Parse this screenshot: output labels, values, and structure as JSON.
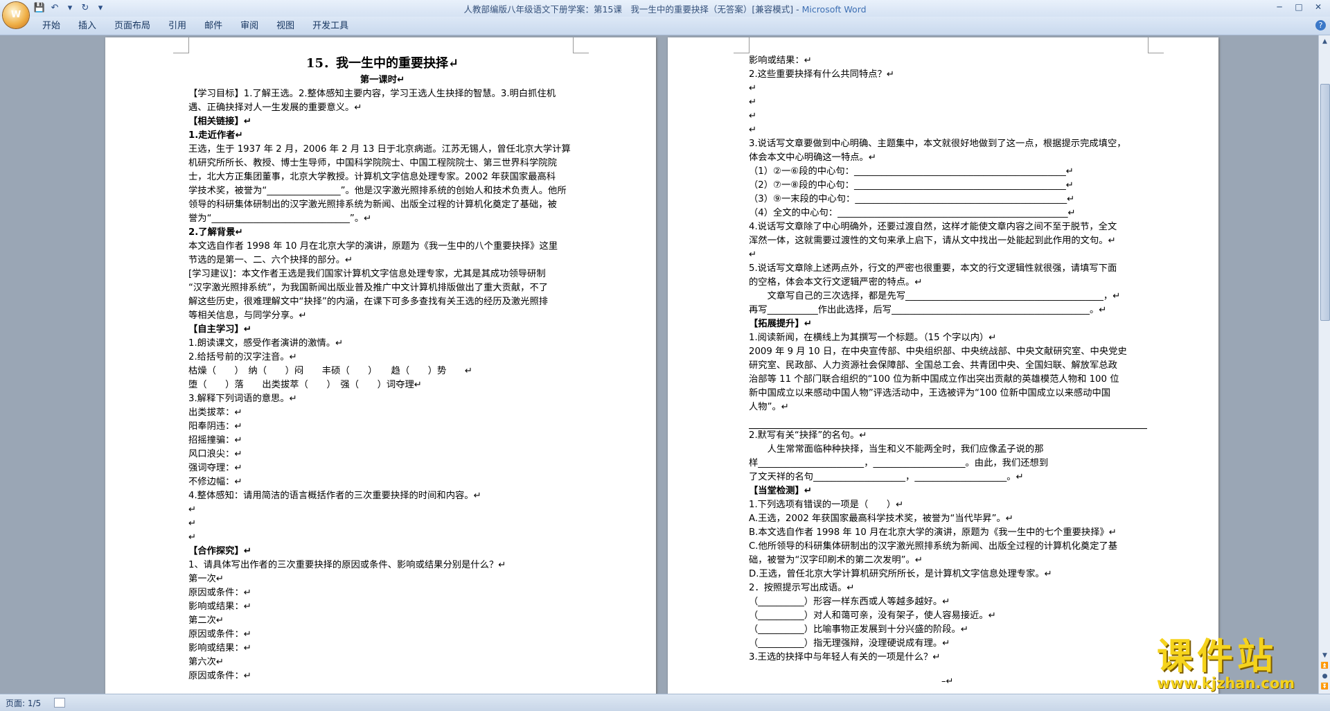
{
  "window": {
    "title": "人教部编版八年级语文下册学案：第15课　我一生中的重要抉择（无答案）[兼容模式] - ",
    "app_name": "Microsoft Word"
  },
  "office_button": {
    "icon": "office-logo-icon"
  },
  "quick_access": [
    {
      "name": "save",
      "icon": "💾"
    },
    {
      "name": "undo",
      "icon": "↶"
    },
    {
      "name": "undo-dropdown",
      "icon": "▾"
    },
    {
      "name": "redo",
      "icon": "↻"
    },
    {
      "name": "customize",
      "icon": "▾"
    }
  ],
  "window_controls": {
    "minimize": "─",
    "maximize": "□",
    "close": "✕"
  },
  "ribbon": {
    "tabs": [
      "开始",
      "插入",
      "页面布局",
      "引用",
      "邮件",
      "审阅",
      "视图",
      "开发工具"
    ],
    "help": "?"
  },
  "page1": {
    "lines": [
      {
        "t": "15．我一生中的重要抉择↵",
        "s": "title"
      },
      {
        "t": "第一课时↵",
        "s": "center"
      },
      {
        "t": "【学习目标】1.了解王选。2.整体感知主要内容，学习王选人生抉择的智慧。3.明白抓住机"
      },
      {
        "t": "遇、正确抉择对人一生发展的重要意义。↵"
      },
      {
        "t": "【相关链接】↵",
        "s": "bold"
      },
      {
        "t": "1.走近作者↵",
        "s": "bold"
      },
      {
        "t": "王选，生于 1937 年 2 月，2006 年 2 月 13 日于北京病逝。江苏无锡人，曾任北京大学计算"
      },
      {
        "t": "机研究所所长、教授、博士生导师，中国科学院院士、中国工程院院士、第三世界科学院院"
      },
      {
        "t": "士，北大方正集团董事，北京大学教授。计算机文字信息处理专家。2002 年获国家最高科"
      },
      {
        "t": "学技术奖，被誉为“________________”。他是汉字激光照排系统的创始人和技术负责人。他所"
      },
      {
        "t": "领导的科研集体研制出的汉字激光照排系统为新闻、出版全过程的计算机化奠定了基础，被"
      },
      {
        "t": "誉为“______________________________”。↵"
      },
      {
        "t": "2.了解背景↵",
        "s": "bold"
      },
      {
        "t": "本文选自作者 1998 年 10 月在北京大学的演讲，原题为《我一生中的八个重要抉择》这里"
      },
      {
        "t": "节选的是第一、二、六个抉择的部分。↵"
      },
      {
        "t": "[学习建议]：本文作者王选是我们国家计算机文字信息处理专家，尤其是其成功领导研制"
      },
      {
        "t": "“汉字激光照排系统”，为我国新闻出版业普及推广中文计算机排版做出了重大贡献，不了"
      },
      {
        "t": "解这些历史，很难理解文中“抉择”的内涵，在课下可多多查找有关王选的经历及激光照排"
      },
      {
        "t": "等相关信息，与同学分享。↵"
      },
      {
        "t": "【自主学习】↵",
        "s": "bold"
      },
      {
        "t": "1.朗读课文，感受作者演讲的激情。↵"
      },
      {
        "t": "2.给括号前的汉字注音。↵"
      },
      {
        "t": "枯燥（　　）　纳（　　）闷　　丰硕（　　）　　趋（　　）势　　↵"
      },
      {
        "t": "堕（　　）落　　出类拔萃（　　）　强（　　）词夺理↵"
      },
      {
        "t": "3.解释下列词语的意思。↵"
      },
      {
        "t": "出类拔萃：↵"
      },
      {
        "t": "阳奉阴违：↵"
      },
      {
        "t": "招摇撞骗：↵"
      },
      {
        "t": "风口浪尖：↵"
      },
      {
        "t": "强词夺理：↵"
      },
      {
        "t": "不修边幅：↵"
      },
      {
        "t": "4.整体感知：请用简洁的语言概括作者的三次重要抉择的时间和内容。↵"
      },
      {
        "t": "↵"
      },
      {
        "t": "↵"
      },
      {
        "t": "↵"
      },
      {
        "t": "【合作探究】↵",
        "s": "bold"
      },
      {
        "t": "1、请具体写出作者的三次重要抉择的原因或条件、影响或结果分别是什么？↵"
      },
      {
        "t": "第一次↵"
      },
      {
        "t": "原因或条件：↵"
      },
      {
        "t": "影响或结果：↵"
      },
      {
        "t": "第二次↵"
      },
      {
        "t": "原因或条件：↵"
      },
      {
        "t": "影响或结果：↵"
      },
      {
        "t": "第六次↵"
      },
      {
        "t": "原因或条件：↵"
      }
    ]
  },
  "page2": {
    "lines": [
      {
        "t": "影响或结果：↵"
      },
      {
        "t": "2.这些重要抉择有什么共同特点？↵"
      },
      {
        "t": "↵"
      },
      {
        "t": "↵"
      },
      {
        "t": "↵"
      },
      {
        "t": "↵"
      },
      {
        "t": "3.说话写文章要做到中心明确、主题集中，本文就很好地做到了这一点，根据提示完成填空，"
      },
      {
        "t": "体会本文中心明确这一特点。↵"
      },
      {
        "t": "（1）②一⑥段的中心句：______________________________________________↵"
      },
      {
        "t": "（2）⑦一⑧段的中心句：______________________________________________↵"
      },
      {
        "t": "（3）⑨一末段的中心句：______________________________________________↵"
      },
      {
        "t": "（4）全文的中心句：__________________________________________________↵"
      },
      {
        "t": "4.说话写文章除了中心明确外，还要过渡自然，这样才能使文章内容之间不至于脱节，全文"
      },
      {
        "t": "浑然一体，这就需要过渡性的文句来承上启下，请从文中找出一处能起到此作用的文句。↵"
      },
      {
        "t": "↵"
      },
      {
        "t": "5.说话写文章除上述两点外，行文的严密也很重要，本文的行文逻辑性就很强，请填写下面"
      },
      {
        "t": "的空格，体会本文行文逻辑严密的特点。↵"
      },
      {
        "t": "　　文章写自己的三次选择，都是先写___________________________________________，↵"
      },
      {
        "t": "再写___________作出此选择，后写___________________________________________。↵"
      },
      {
        "t": "【拓展提升】↵",
        "s": "bold"
      },
      {
        "t": "1.阅读新闻，在横线上为其撰写一个标题。（15 个字以内）↵"
      },
      {
        "t": "2009 年 9 月 10 日，在中央宣传部、中央组织部、中央统战部、中央文献研究室、中央党史"
      },
      {
        "t": "研究室、民政部、人力资源社会保障部、全国总工会、共青团中央、全国妇联、解放军总政"
      },
      {
        "t": "治部等 11 个部门联合组织的“100 位为新中国成立作出突出贡献的英雄模范人物和 100 位"
      },
      {
        "t": "新中国成立以来感动中国人物”评选活动中，王选被评为“100 位新中国成立以来感动中国"
      },
      {
        "t": "人物”。↵"
      },
      {
        "t": "",
        "s": "rule"
      },
      {
        "t": "2.默写有关“抉择”的名句。↵"
      },
      {
        "t": "　　人生常常面临种种抉择，当生和义不能两全时，我们应像孟子说的那"
      },
      {
        "t": "样_______________________，____________________。由此，我们还想到"
      },
      {
        "t": "了文天祥的名句____________________，____________________。↵"
      },
      {
        "t": "【当堂检测】↵",
        "s": "bold"
      },
      {
        "t": "1.下列选项有错误的一项是（　　）↵"
      },
      {
        "t": "A.王选，2002 年获国家最高科学技术奖，被誉为“当代毕昇”。↵"
      },
      {
        "t": "B.本文选自作者 1998 年 10 月在北京大学的演讲，原题为《我一生中的七个重要抉择》↵"
      },
      {
        "t": "C.他所领导的科研集体研制出的汉字激光照排系统为新闻、出版全过程的计算机化奠定了基"
      },
      {
        "t": "础，被誉为“汉字印刷术的第二次发明”。↵"
      },
      {
        "t": "D.王选，曾任北京大学计算机研究所所长，是计算机文字信息处理专家。↵"
      },
      {
        "t": "2．按照提示写出成语。↵"
      },
      {
        "t": "（__________）形容一样东西或人等越多越好。↵"
      },
      {
        "t": "（__________）对人和蔼可亲，没有架子，使人容易接近。↵"
      },
      {
        "t": "（__________）比喻事物正发展到十分兴盛的阶段。↵"
      },
      {
        "t": "（__________）指无理强辩，没理硬说成有理。↵"
      },
      {
        "t": "3.王选的抉择中与年轻人有关的一项是什么？↵"
      }
    ],
    "footer_mark": "–↵"
  },
  "scrollbar": {
    "up": "▲",
    "down": "▼",
    "prev_page": "⏫",
    "next_page": "⏬",
    "select_browse": "●"
  },
  "status": {
    "page": "页面: 1/5"
  },
  "watermark": {
    "big": "课件站",
    "url": "www.kjzhan.com"
  },
  "colors": {
    "page_bg": "#ffffff",
    "workspace": "#9aa6b5",
    "ribbon": "#c9d9ee",
    "watermark": "#f5d31c"
  }
}
